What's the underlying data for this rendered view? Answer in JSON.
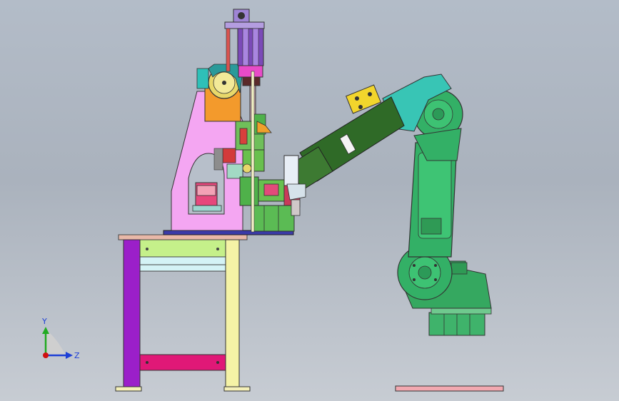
{
  "scene": {
    "background_top": "#b3bcc8",
    "background_bottom": "#c7ccd3"
  },
  "triad": {
    "y_label": "Y",
    "z_label": "Z",
    "y_color": "#22aa22",
    "z_color": "#1d3fd6",
    "origin_color": "#d01010"
  },
  "parts": {
    "table_color": "#c5f08a",
    "table_leg_left_color": "#9b1fc9",
    "table_leg_right_color": "#f5f3a6",
    "press_frame_color": "#f4a6f2",
    "press_motor_color": "#f39a2c",
    "cylinder_color": "#7b4ab8",
    "robot_color": "#33b066",
    "robot_forearm_color": "#2f6a27",
    "robot_wrist_color": "#38c5b5",
    "gripper_color": "#f2d52c",
    "robot_base_plate_color": "#f2a8b0"
  }
}
